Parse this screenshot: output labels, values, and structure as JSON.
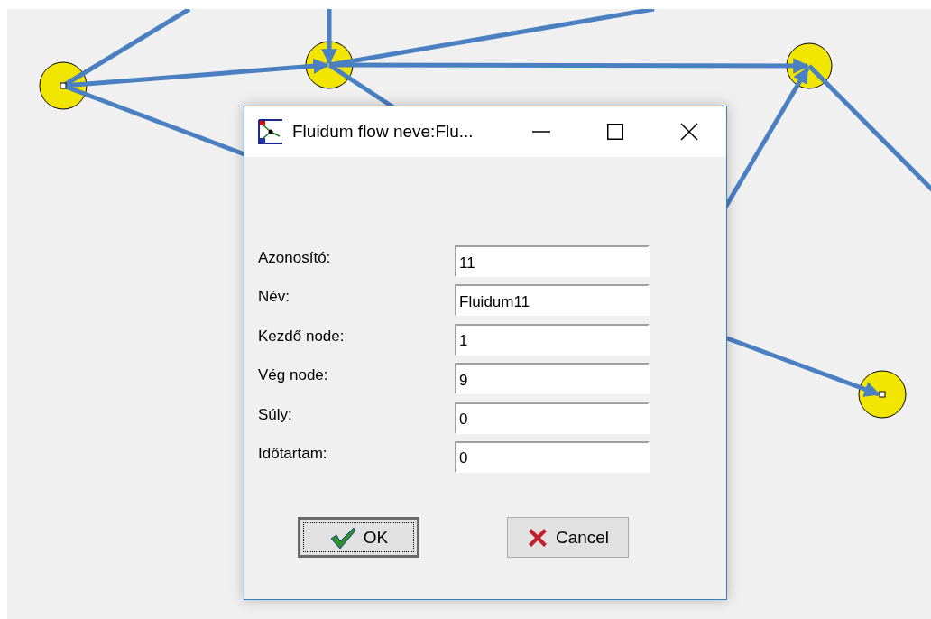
{
  "dialog": {
    "title": "Fluidum flow neve:Flu...",
    "fields": [
      {
        "label": "Azonosító:",
        "value": "11"
      },
      {
        "label": "Név:",
        "value": "Fluidum11"
      },
      {
        "label": "Kezdő node:",
        "value": "1"
      },
      {
        "label": "Vég node:",
        "value": "9"
      },
      {
        "label": "Súly:",
        "value": "0"
      },
      {
        "label": "Időtartam:",
        "value": "0"
      }
    ],
    "buttons": [
      {
        "kind": "ok",
        "label": "OK",
        "focused": true
      },
      {
        "kind": "cancel",
        "label": "Cancel",
        "focused": false
      }
    ]
  }
}
